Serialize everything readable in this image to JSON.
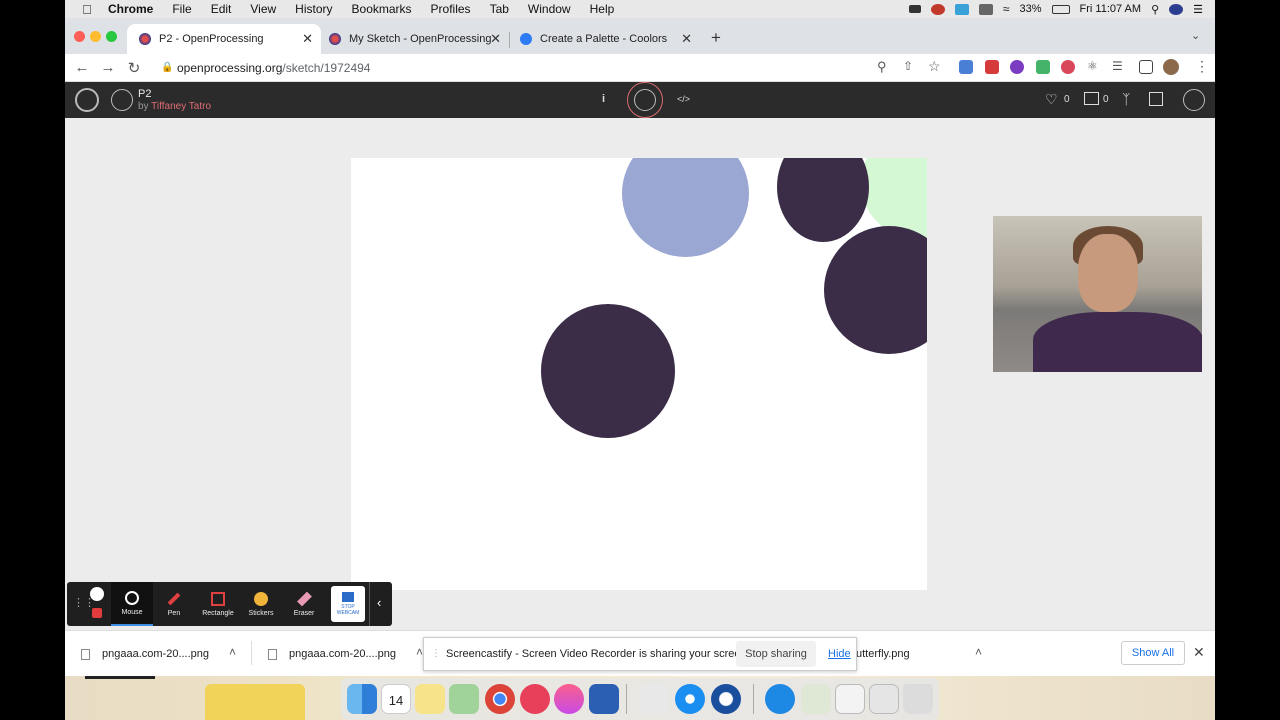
{
  "menubar": {
    "app": "Chrome",
    "items": [
      "File",
      "Edit",
      "View",
      "History",
      "Bookmarks",
      "Profiles",
      "Tab",
      "Window",
      "Help"
    ],
    "battery": "33%",
    "clock": "Fri 11:07 AM"
  },
  "tabs": [
    {
      "title": "P2 - OpenProcessing",
      "active": true
    },
    {
      "title": "My Sketch - OpenProcessing",
      "active": false
    },
    {
      "title": "Create a Palette - Coolors",
      "active": false
    }
  ],
  "address": {
    "host": "openprocessing.org",
    "path": "/sketch/1972494"
  },
  "sketch": {
    "title": "P2",
    "by_prefix": "by ",
    "author": "Tiffaney Tatro",
    "info_label": "i",
    "code_label": "</>",
    "likes": "0",
    "comments": "0"
  },
  "canvas_colors": {
    "dark": "#3b2d48",
    "blue": "#9ba7d3",
    "green": "#d4f7d4"
  },
  "screencastify_toolbar": {
    "tools": [
      "Mouse",
      "Pen",
      "Rectangle",
      "Stickers",
      "Eraser"
    ],
    "stop_webcam": "STOP WEBCAM"
  },
  "downloads": {
    "items": [
      "pngaaa.com-20....png",
      "pngaaa.com-20....png",
      "utterfly.png"
    ],
    "show_all": "Show All"
  },
  "share_notice": {
    "message": "Screencastify - Screen Video Recorder is sharing your screen.",
    "stop": "Stop sharing",
    "hide": "Hide"
  },
  "dock": {
    "calendar_day": "14"
  }
}
